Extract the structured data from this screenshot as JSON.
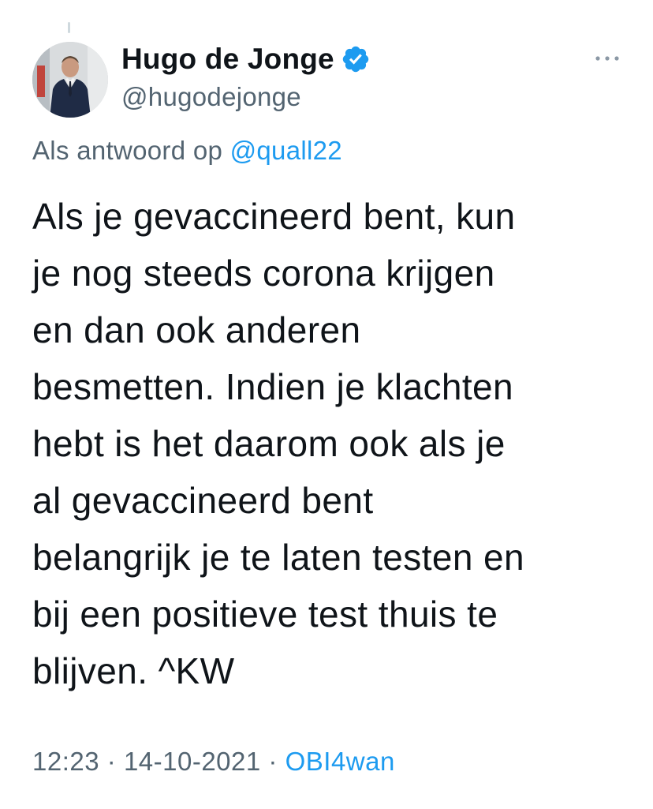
{
  "author": {
    "display_name": "Hugo de Jonge",
    "handle": "@hugodejonge",
    "verified": true,
    "verified_color": "#1d9bf0"
  },
  "reply_context": {
    "prefix": "Als antwoord op",
    "mention": "@quall22"
  },
  "tweet": {
    "lines": [
      "Als je gevaccineerd bent, kun",
      "je nog steeds corona krijgen",
      "en dan ook anderen",
      "besmetten. Indien je klachten",
      "hebt is het daarom ook als je",
      "al gevaccineerd bent",
      "belangrijk je te laten testen en",
      "bij een positieve test thuis te",
      "blijven. ^KW"
    ]
  },
  "meta": {
    "time": "12:23",
    "separator": "·",
    "date": "14-10-2021",
    "source": "OBI4wan"
  },
  "icons": {
    "more": "more-icon",
    "verified": "verified-badge-icon"
  },
  "colors": {
    "text": "#0f1419",
    "secondary": "#536471",
    "link": "#1d9bf0"
  }
}
